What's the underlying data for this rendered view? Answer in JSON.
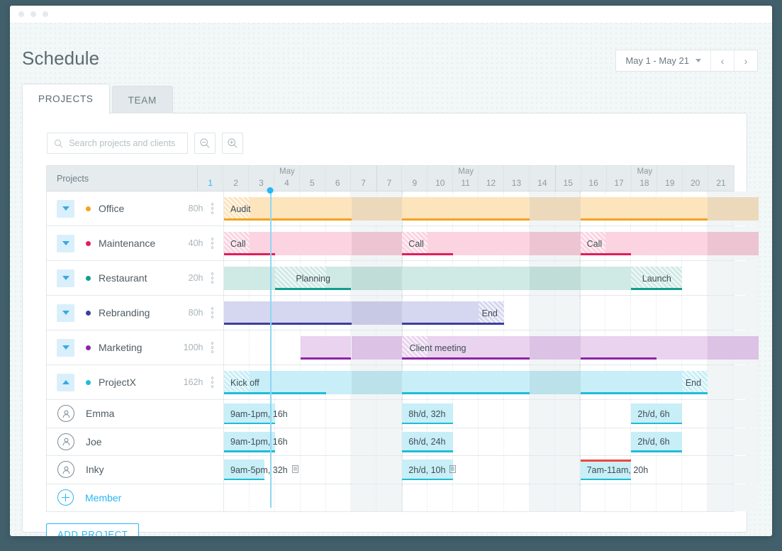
{
  "window": {
    "dots": 3
  },
  "header": {
    "title": "Schedule",
    "date_range": "May 1 - May 21",
    "prev_label": "‹",
    "next_label": "›"
  },
  "tabs": [
    {
      "label": "PROJECTS",
      "active": true
    },
    {
      "label": "TEAM",
      "active": false
    }
  ],
  "toolbar": {
    "search_placeholder": "Search projects and clients",
    "search_value": "",
    "zoom_out_label": "zoom-out",
    "zoom_in_label": "zoom-in"
  },
  "grid": {
    "label_header": "Projects",
    "weeks": [
      {
        "month": "May",
        "days": [
          "1",
          "2",
          "3",
          "4",
          "5",
          "6",
          "7"
        ]
      },
      {
        "month": "May",
        "days": [
          "7",
          "9",
          "10",
          "11",
          "12",
          "13",
          "14"
        ]
      },
      {
        "month": "May",
        "days": [
          "15",
          "16",
          "17",
          "18",
          "19",
          "20",
          "21"
        ]
      }
    ],
    "today_index": 0,
    "weekend_columns": [
      5,
      6,
      12,
      13,
      19,
      20
    ]
  },
  "projects": [
    {
      "name": "Office",
      "hours": "80h",
      "color": "#f6a21d",
      "expanded": false,
      "bars": [
        {
          "start": 0,
          "span": 5,
          "fill": "#fce4bd",
          "line": "#f6a21d",
          "hatch_start": 0,
          "hatch_span": 1,
          "label": "Audit",
          "align": "left"
        },
        {
          "start": 5,
          "span": 2,
          "fill": "#ecd9bc",
          "line": "",
          "hatch_start": null,
          "hatch_span": 0,
          "label": "",
          "align": "left"
        },
        {
          "start": 7,
          "span": 5,
          "fill": "#fce4bd",
          "line": "#f6a21d",
          "hatch_start": null,
          "hatch_span": 0,
          "label": "",
          "align": "left"
        },
        {
          "start": 12,
          "span": 2,
          "fill": "#ecd9bc",
          "line": "",
          "hatch_start": null,
          "hatch_span": 0,
          "label": "",
          "align": "left"
        },
        {
          "start": 14,
          "span": 5,
          "fill": "#fce4bd",
          "line": "#f6a21d",
          "hatch_start": null,
          "hatch_span": 0,
          "label": "",
          "align": "left"
        },
        {
          "start": 19,
          "span": 2,
          "fill": "#ecd9bc",
          "line": "",
          "hatch_start": null,
          "hatch_span": 0,
          "label": "",
          "align": "left"
        }
      ]
    },
    {
      "name": "Maintenance",
      "hours": "40h",
      "color": "#e01e5a",
      "expanded": false,
      "bars": [
        {
          "start": 0,
          "span": 5,
          "fill": "#fbd3e1",
          "line": "#e01e5a",
          "line_span": 2,
          "hatch_start": 0,
          "hatch_span": 1,
          "label": "Call",
          "align": "left"
        },
        {
          "start": 5,
          "span": 2,
          "fill": "#ecc4d2",
          "line": "",
          "hatch_start": null,
          "hatch_span": 0,
          "label": "",
          "align": "left"
        },
        {
          "start": 7,
          "span": 5,
          "fill": "#fbd3e1",
          "line": "#e01e5a",
          "line_span": 2,
          "hatch_start": 7,
          "hatch_span": 1,
          "label": "Call",
          "align": "left"
        },
        {
          "start": 12,
          "span": 2,
          "fill": "#ecc4d2",
          "line": "",
          "hatch_start": null,
          "hatch_span": 0,
          "label": "",
          "align": "left"
        },
        {
          "start": 14,
          "span": 5,
          "fill": "#fbd3e1",
          "line": "#e01e5a",
          "line_span": 2,
          "hatch_start": 14,
          "hatch_span": 1,
          "label": "Call",
          "align": "left"
        },
        {
          "start": 19,
          "span": 2,
          "fill": "#ecc4d2",
          "line": "",
          "hatch_start": null,
          "hatch_span": 0,
          "label": "",
          "align": "left"
        }
      ]
    },
    {
      "name": "Restaurant",
      "hours": "20h",
      "color": "#0f9e8e",
      "expanded": false,
      "bars": [
        {
          "start": 0,
          "span": 5,
          "fill": "#cfe9e4",
          "line": "#0f9e8e",
          "line_start": 2,
          "line_span": 3,
          "hatch_start": 2,
          "hatch_span": 2,
          "label": "Planning",
          "align": "center_at",
          "label_col": 3.5
        },
        {
          "start": 5,
          "span": 2,
          "fill": "#c1ddd8",
          "line": "",
          "hatch_start": null,
          "hatch_span": 0,
          "label": "",
          "align": "left"
        },
        {
          "start": 7,
          "span": 5,
          "fill": "#cfe9e4",
          "line": "",
          "hatch_start": null,
          "hatch_span": 0,
          "label": "",
          "align": "left"
        },
        {
          "start": 12,
          "span": 2,
          "fill": "#c1ddd8",
          "line": "",
          "hatch_start": null,
          "hatch_span": 0,
          "label": "",
          "align": "left"
        },
        {
          "start": 14,
          "span": 4,
          "fill": "#cfe9e4",
          "line": "#0f9e8e",
          "line_start": 16,
          "line_span": 2,
          "hatch_start": 16,
          "hatch_span": 2,
          "label": "Launch",
          "align": "center_at",
          "label_col": 17
        }
      ]
    },
    {
      "name": "Rebranding",
      "hours": "80h",
      "color": "#3a3f9e",
      "expanded": false,
      "bars": [
        {
          "start": 0,
          "span": 5,
          "fill": "#d5d6ef",
          "line": "#3a3f9e",
          "line_span": 5,
          "hatch_start": null,
          "hatch_span": 0,
          "label": "",
          "align": "left"
        },
        {
          "start": 5,
          "span": 2,
          "fill": "#c8cae5",
          "line": "",
          "hatch_start": null,
          "hatch_span": 0,
          "label": "",
          "align": "left"
        },
        {
          "start": 7,
          "span": 4,
          "fill": "#d5d6ef",
          "line": "#3a3f9e",
          "line_span": 4,
          "hatch_start": 10,
          "hatch_span": 1,
          "label": "End",
          "align": "right"
        }
      ]
    },
    {
      "name": "Marketing",
      "hours": "100h",
      "color": "#8e24aa",
      "expanded": false,
      "bars": [
        {
          "start": 3,
          "span": 2,
          "fill": "#e9d3ef",
          "line": "#8e24aa",
          "line_span": 2,
          "hatch_start": null,
          "hatch_span": 0,
          "label": "",
          "align": "left"
        },
        {
          "start": 5,
          "span": 2,
          "fill": "#dcc2e4",
          "line": "",
          "hatch_start": null,
          "hatch_span": 0,
          "label": "",
          "align": "left"
        },
        {
          "start": 7,
          "span": 5,
          "fill": "#e9d3ef",
          "line": "#8e24aa",
          "line_span": 5,
          "hatch_start": 7,
          "hatch_span": 1,
          "label": "Client meeting",
          "align": "center_at",
          "label_col": 8.4
        },
        {
          "start": 12,
          "span": 2,
          "fill": "#dcc2e4",
          "line": "",
          "hatch_start": null,
          "hatch_span": 0,
          "label": "",
          "align": "left"
        },
        {
          "start": 14,
          "span": 5,
          "fill": "#e9d3ef",
          "line": "#8e24aa",
          "line_span": 3,
          "hatch_start": null,
          "hatch_span": 0,
          "label": "",
          "align": "left"
        },
        {
          "start": 19,
          "span": 2,
          "fill": "#dcc2e4",
          "line": "",
          "hatch_start": null,
          "hatch_span": 0,
          "label": "",
          "align": "left"
        }
      ]
    },
    {
      "name": "ProjectX",
      "hours": "162h",
      "color": "#1fbcd6",
      "expanded": true,
      "bars": [
        {
          "start": 0,
          "span": 5,
          "fill": "#c8eef7",
          "line": "#1fbcd6",
          "line_span": 4,
          "hatch_start": 0,
          "hatch_span": 1,
          "label": "Kick off",
          "align": "left"
        },
        {
          "start": 5,
          "span": 2,
          "fill": "#bbe1ea",
          "line": "",
          "hatch_start": null,
          "hatch_span": 0,
          "label": "",
          "align": "left"
        },
        {
          "start": 7,
          "span": 5,
          "fill": "#c8eef7",
          "line": "#1fbcd6",
          "line_span": 5,
          "hatch_start": null,
          "hatch_span": 0,
          "label": "",
          "align": "left"
        },
        {
          "start": 12,
          "span": 2,
          "fill": "#bbe1ea",
          "line": "",
          "hatch_start": null,
          "hatch_span": 0,
          "label": "",
          "align": "left"
        },
        {
          "start": 14,
          "span": 5,
          "fill": "#c8eef7",
          "line": "#1fbcd6",
          "line_span": 5,
          "hatch_start": 18,
          "hatch_span": 1,
          "label": "End",
          "align": "right"
        }
      ]
    }
  ],
  "members": [
    {
      "name": "Emma",
      "avatar": "avatar-emma",
      "chips": [
        {
          "start": 0,
          "span": 2,
          "text": "9am-1pm, 16h",
          "note": false,
          "over": false
        },
        {
          "start": 7,
          "span": 2,
          "text": "8h/d, 32h",
          "note": false,
          "over": false
        },
        {
          "start": 16,
          "span": 2,
          "text": "2h/d, 6h",
          "note": false,
          "over": false
        }
      ]
    },
    {
      "name": "Joe",
      "avatar": "avatar-joe",
      "chips": [
        {
          "start": 0,
          "span": 2,
          "text": "9am-1pm, 16h",
          "note": false,
          "over": false
        },
        {
          "start": 7,
          "span": 2,
          "text": "6h/d, 24h",
          "note": false,
          "over": false
        },
        {
          "start": 16,
          "span": 2,
          "text": "2h/d, 6h",
          "note": false,
          "over": false
        }
      ]
    },
    {
      "name": "Inky",
      "avatar": "avatar-inky",
      "chips": [
        {
          "start": 0,
          "span": 1.6,
          "text": "9am-5pm, 32h",
          "note": true,
          "over": false
        },
        {
          "start": 7,
          "span": 2,
          "text": "2h/d, 10h",
          "note": true,
          "over": false
        },
        {
          "start": 14,
          "span": 2,
          "text": "7am-11am, 20h",
          "note": false,
          "over": true
        }
      ]
    }
  ],
  "add_member": {
    "label": "Member"
  },
  "footer": {
    "add_project_label": "ADD PROJECT"
  }
}
